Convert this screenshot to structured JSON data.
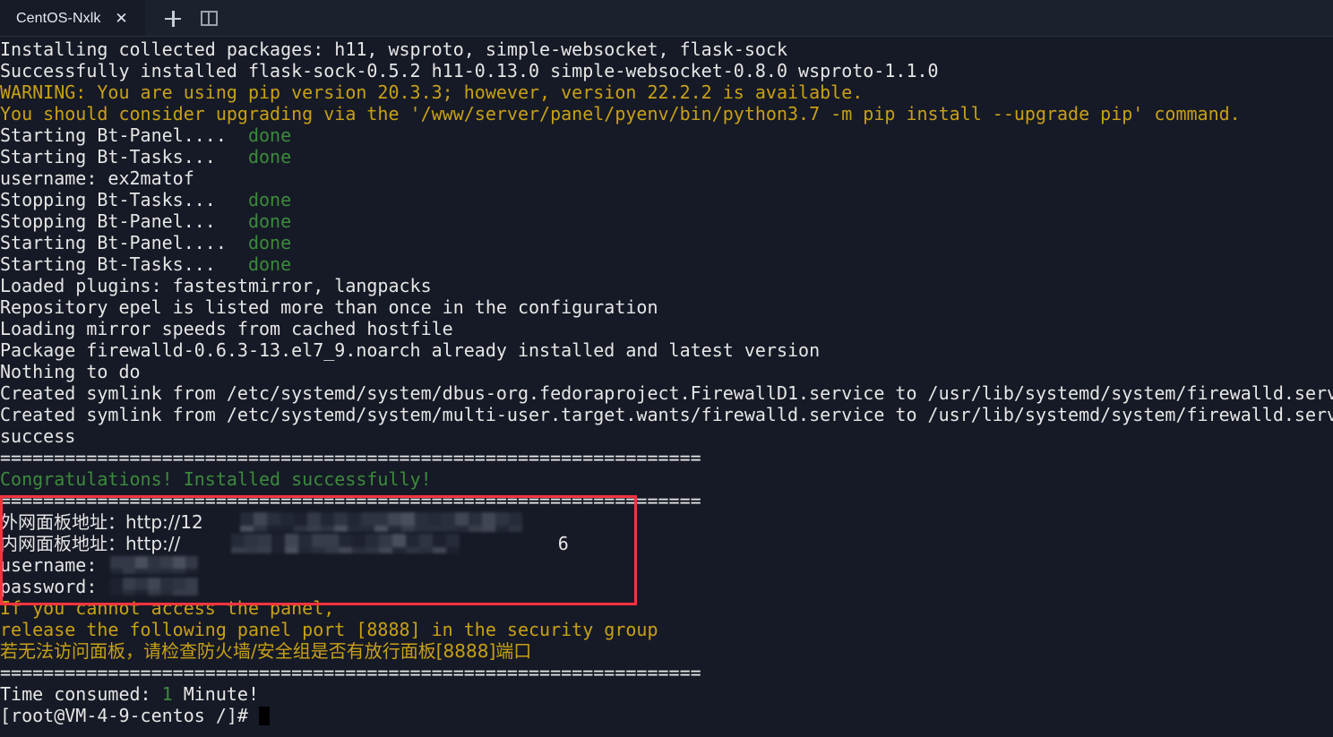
{
  "window": {
    "tab": {
      "title": "CentOS-Nxlk",
      "close_label": "✕"
    },
    "new_tab_label": "+",
    "split_pane_label": "split"
  },
  "terminal": {
    "prompt": "[root@VM-4-9-centos /]#",
    "separator": "=================================================================",
    "lines": [
      {
        "id": "l01",
        "text": "Installing collected packages: h11, wsproto, simple-websocket, flask-sock",
        "color": "white"
      },
      {
        "id": "l02",
        "text": "Successfully installed flask-sock-0.5.2 h11-0.13.0 simple-websocket-0.8.0 wsproto-1.1.0",
        "color": "white"
      },
      {
        "id": "l03",
        "text": "WARNING: You are using pip version 20.3.3; however, version 22.2.2 is available.",
        "color": "yellow"
      },
      {
        "id": "l04",
        "text": "You should consider upgrading via the '/www/server/panel/pyenv/bin/python3.7 -m pip install --upgrade pip' command.",
        "color": "yellow"
      },
      {
        "id": "l05",
        "text": "Starting Bt-Panel....",
        "suffix": "done",
        "color": "white",
        "suffix_color": "green"
      },
      {
        "id": "l06",
        "text": "Starting Bt-Tasks...",
        "suffix": "done",
        "color": "white",
        "suffix_color": "green"
      },
      {
        "id": "l07",
        "text": "username: ex2matof",
        "color": "white"
      },
      {
        "id": "l08",
        "text": "Stopping Bt-Tasks...",
        "suffix": "done",
        "color": "white",
        "suffix_color": "green"
      },
      {
        "id": "l09",
        "text": "Stopping Bt-Panel...",
        "suffix": "done",
        "color": "white",
        "suffix_color": "green"
      },
      {
        "id": "l10",
        "text": "Starting Bt-Panel....",
        "suffix": "done",
        "color": "white",
        "suffix_color": "green"
      },
      {
        "id": "l11",
        "text": "Starting Bt-Tasks...",
        "suffix": "done",
        "color": "white",
        "suffix_color": "green"
      },
      {
        "id": "l12",
        "text": "Loaded plugins: fastestmirror, langpacks",
        "color": "white"
      },
      {
        "id": "l13",
        "text": "Repository epel is listed more than once in the configuration",
        "color": "white"
      },
      {
        "id": "l14",
        "text": "Loading mirror speeds from cached hostfile",
        "color": "white"
      },
      {
        "id": "l15",
        "text": "Package firewalld-0.6.3-13.el7_9.noarch already installed and latest version",
        "color": "white"
      },
      {
        "id": "l16",
        "text": "Nothing to do",
        "color": "white"
      },
      {
        "id": "l17",
        "text": "Created symlink from /etc/systemd/system/dbus-org.fedoraproject.FirewallD1.service to /usr/lib/systemd/system/firewalld.serv",
        "color": "white"
      },
      {
        "id": "l18",
        "text": "Created symlink from /etc/systemd/system/multi-user.target.wants/firewalld.service to /usr/lib/systemd/system/firewalld.serv",
        "color": "white"
      },
      {
        "id": "l19",
        "text": "success",
        "color": "white"
      },
      {
        "id": "l20",
        "text": "=================================================================",
        "color": "sep"
      },
      {
        "id": "l21",
        "text": "Congratulations! Installed successfully!",
        "color": "green"
      },
      {
        "id": "l22",
        "text": "=================================================================",
        "color": "sep"
      },
      {
        "id": "l23",
        "text": "外网面板地址：http://12",
        "color": "white",
        "cjk": true,
        "redacted": true
      },
      {
        "id": "l24",
        "text": "内网面板地址：http://",
        "color": "white",
        "cjk": true,
        "redacted": true,
        "tail": "6"
      },
      {
        "id": "l25",
        "text": "username:",
        "color": "white",
        "redacted": true
      },
      {
        "id": "l26",
        "text": "password:",
        "color": "white",
        "redacted": true
      },
      {
        "id": "l27",
        "text": "If you cannot access the panel,",
        "color": "yellow"
      },
      {
        "id": "l28",
        "text": "release the following panel port [8888] in the security group",
        "color": "yellow"
      },
      {
        "id": "l29",
        "text": "若无法访问面板，请检查防火墙/安全组是否有放行面板[8888]端口",
        "color": "yellow",
        "cjk": true
      },
      {
        "id": "l30",
        "text": "=================================================================",
        "color": "sep"
      },
      {
        "id": "l31",
        "text": "Time consumed: ",
        "color": "white",
        "inline": [
          {
            "text": "1",
            "color": "green"
          },
          {
            "text": " Minute!",
            "color": "white"
          }
        ]
      },
      {
        "id": "l32",
        "text": "[root@VM-4-9-centos /]# ",
        "color": "white",
        "cursor": true
      }
    ],
    "panel_info": {
      "external_label": "外网面板地址：",
      "internal_label": "内网面板地址：",
      "external_value": "http://12",
      "internal_value": "http://",
      "internal_tail": "6",
      "username_label": "username:",
      "password_label": "password:",
      "username_value": "",
      "password_value": ""
    },
    "time_consumed": {
      "label": "Time consumed: ",
      "value": "1",
      "unit": " Minute!"
    }
  },
  "colors": {
    "background": "#161a26",
    "tabbar": "#1c212e",
    "active_tab": "#171b27",
    "text": "#e6e6e6",
    "green": "#3c8a3c",
    "yellow": "#c8a016",
    "highlight_box": "#f5333f",
    "cursor": "#000000"
  }
}
